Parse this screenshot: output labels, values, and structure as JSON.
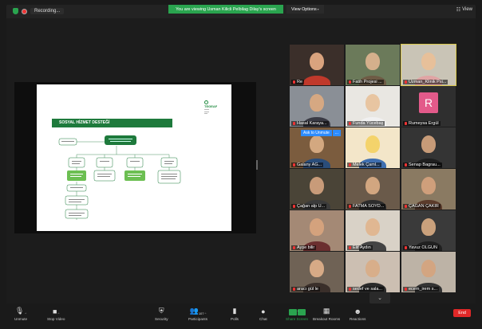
{
  "top": {
    "recording_label": "Recording...",
    "share_banner": "You are viewing Usman Kilicli Pelbilag Dilay's screen",
    "view_options_label": "View Options",
    "view_label": "View"
  },
  "slide": {
    "title": "SOSYAL HİZMET DESTEĞİ",
    "logo_text": "TEGEAF"
  },
  "gallery": {
    "tiles": [
      {
        "name": "Re"
      },
      {
        "name": "Fatih Projesi ..."
      },
      {
        "name": "Uzman_Klinik Psi..."
      },
      {
        "name": "Hasal Karaya..."
      },
      {
        "name": "Funda Yücebaş"
      },
      {
        "name": "Rumeysa Ergül",
        "letter": "R"
      },
      {
        "name": "Galany AĞ..."
      },
      {
        "name": "Melek Çaml..."
      },
      {
        "name": "Senap Bagrau..."
      },
      {
        "name": "Çağan alp U..."
      },
      {
        "name": "FATMA SOYD..."
      },
      {
        "name": "ÇAĞAN ÇAKIR"
      },
      {
        "name": "Ayşe bilir"
      },
      {
        "name": "Elif Aydın"
      },
      {
        "name": "Yavuz OLGUN"
      },
      {
        "name": "aracı gül le"
      },
      {
        "name": "sedef ve sala..."
      },
      {
        "name": "ecem_irem s..."
      }
    ],
    "popup_label": "Ask to Unmute",
    "popup_more": "..."
  },
  "toolbar": {
    "unmute": "Unmute",
    "stop_video": "Stop Video",
    "security": "Security",
    "participants": "Participants",
    "participant_count": "107",
    "polls": "Polls",
    "chat": "Chat",
    "share_screen": "Share Screen",
    "breakout_rooms": "Breakout Rooms",
    "reactions": "Reactions",
    "end": "End"
  },
  "colors": {
    "accent_green": "#2aa44f",
    "end_red": "#e02828",
    "slide_green": "#1e7a3c"
  }
}
